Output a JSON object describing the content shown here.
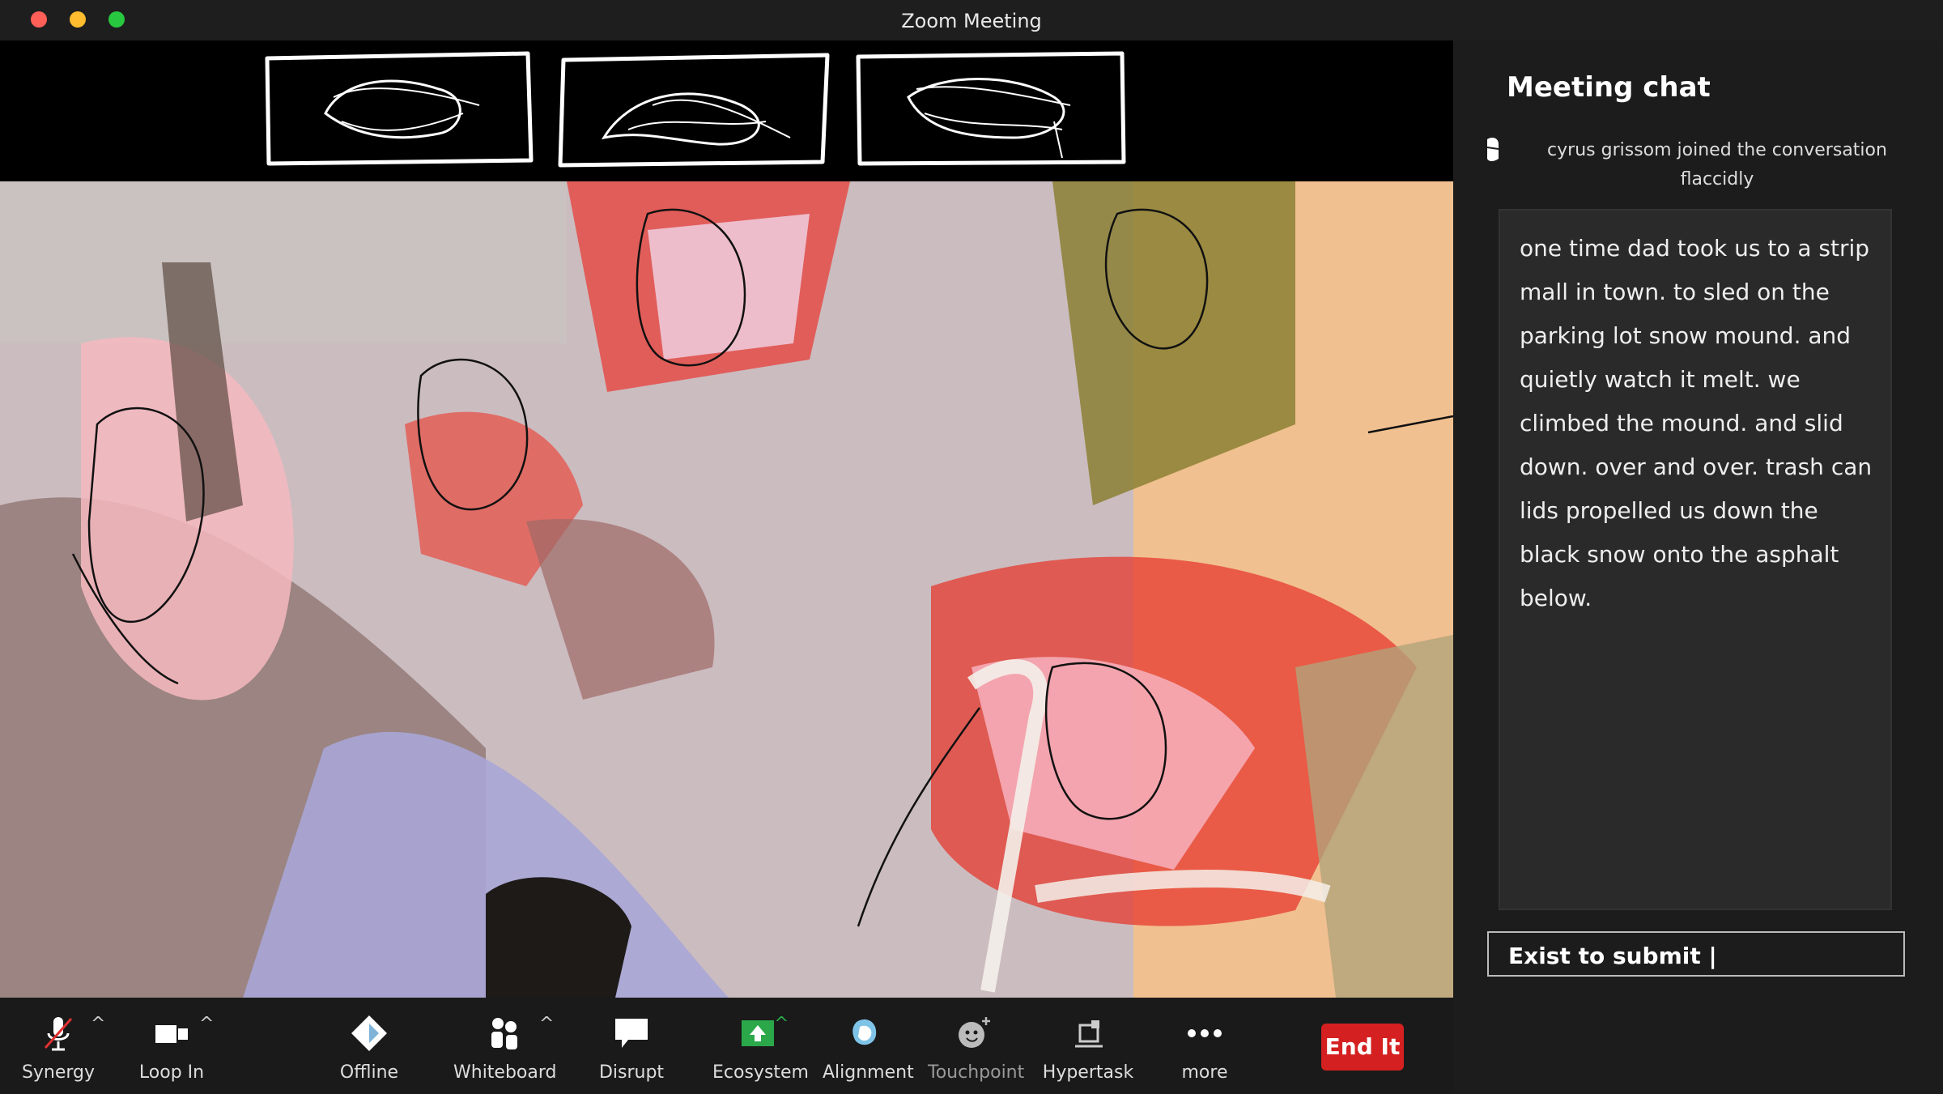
{
  "window": {
    "title": "Zoom Meeting"
  },
  "chat": {
    "title": "Meeting chat",
    "join_notice": "cyrus grissom  joined the conversation flaccidly",
    "message": "one time dad took us to a strip mall in town. to sled on the parking lot snow mound. and quietly watch it melt. we climbed the mound. and slid down. over and over. trash can lids propelled us down the black snow onto the asphalt below.",
    "input_value": "Exist to submit |"
  },
  "toolbar": {
    "synergy": {
      "label": "Synergy",
      "icon": "microphone-muted-icon"
    },
    "loop_in": {
      "label": "Loop In",
      "icon": "video-camera-icon"
    },
    "offline": {
      "label": "Offline",
      "icon": "diamond-icon"
    },
    "whiteboard": {
      "label": "Whiteboard",
      "icon": "participants-icon"
    },
    "disrupt": {
      "label": "Disrupt",
      "icon": "speech-bubble-icon"
    },
    "ecosystem": {
      "label": "Ecosystem",
      "icon": "share-screen-icon"
    },
    "alignment": {
      "label": "Alignment",
      "icon": "blob-icon"
    },
    "touchpoint": {
      "label": "Touchpoint",
      "icon": "reaction-smiley-icon"
    },
    "hypertask": {
      "label": "Hypertask",
      "icon": "apps-icon"
    },
    "more": {
      "label": "more",
      "icon": "ellipsis-icon"
    },
    "end": {
      "label": "End It"
    }
  },
  "colors": {
    "end_button": "#d42020",
    "share_green": "#2aa84a",
    "chat_bg": "#1c1c1c"
  }
}
